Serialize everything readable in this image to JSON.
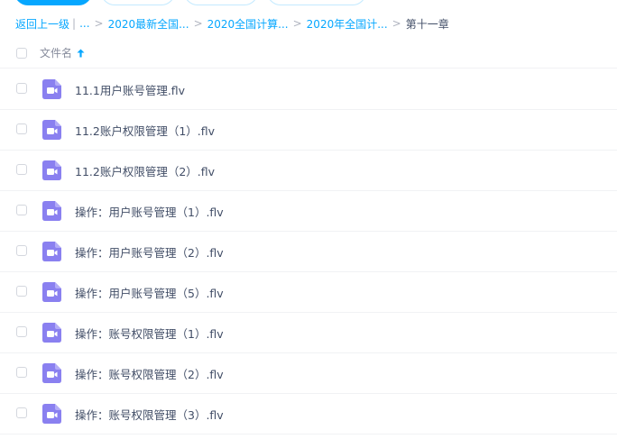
{
  "breadcrumb": {
    "back": "返回上一级",
    "ellipsis": "...",
    "items": [
      "2020最新全国...",
      "2020全国计算...",
      "2020年全国计..."
    ],
    "current": "第十一章"
  },
  "list": {
    "header_label": "文件名",
    "files": [
      {
        "name": "11.1用户账号管理.flv"
      },
      {
        "name": "11.2账户权限管理（1）.flv"
      },
      {
        "name": "11.2账户权限管理（2）.flv"
      },
      {
        "name": "操作：用户账号管理（1）.flv"
      },
      {
        "name": "操作：用户账号管理（2）.flv"
      },
      {
        "name": "操作：用户账号管理（5）.flv"
      },
      {
        "name": "操作：账号权限管理（1）.flv"
      },
      {
        "name": "操作：账号权限管理（2）.flv"
      },
      {
        "name": "操作：账号权限管理（3）.flv"
      }
    ]
  },
  "icons": {
    "file_type": "video-file-icon",
    "sort": "sort-ascending-icon"
  },
  "colors": {
    "accent": "#06a7ff",
    "video_icon": "#8a80f0",
    "text": "#424e67"
  }
}
